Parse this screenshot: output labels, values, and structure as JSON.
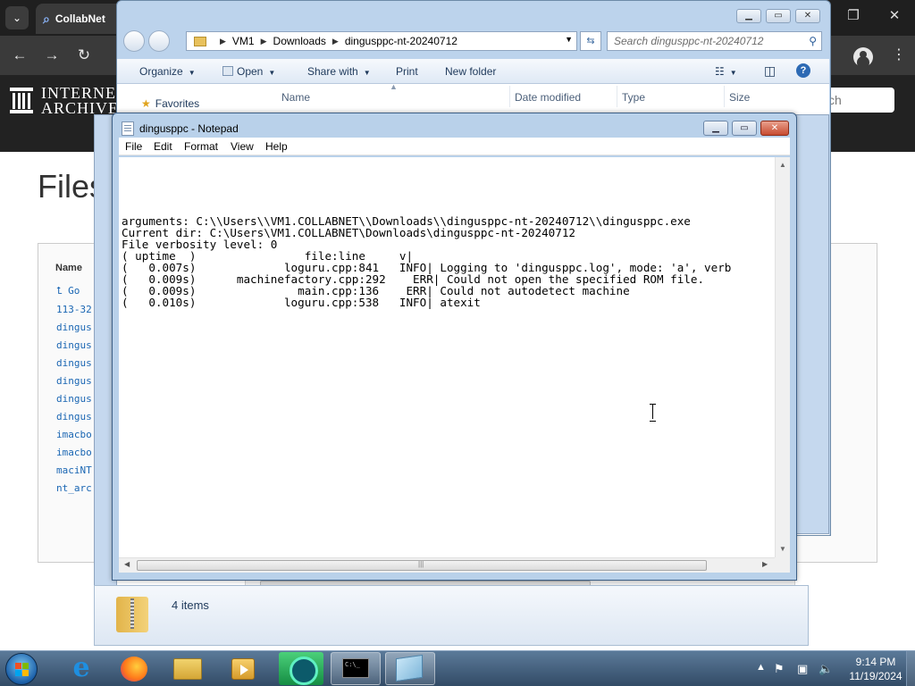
{
  "browser": {
    "tab_title": "CollabNet",
    "ia_logo_text_line1": "INTERNE",
    "ia_logo_text_line2": "ARCHIVE",
    "search_placeholder": "ch",
    "page_title": "Files",
    "files_column_header": "Name",
    "file_links": [
      "Go",
      "113-32",
      "dingus",
      "dingus",
      "dingus",
      "dingus",
      "dingus",
      "dingus",
      "imacbo",
      "imacbo",
      "maciNT",
      "nt_arc"
    ]
  },
  "explorer": {
    "breadcrumb": [
      "VM1",
      "Downloads",
      "dingusppc-nt-20240712"
    ],
    "search_placeholder": "Search dingusppc-nt-20240712",
    "commands": {
      "organize": "Organize",
      "open": "Open",
      "share_with": "Share with",
      "print": "Print",
      "new_folder": "New folder"
    },
    "nav_favorites": "Favorites",
    "columns": {
      "name": "Name",
      "date_modified": "Date modified",
      "type": "Type",
      "size": "Size"
    },
    "details_items": "4 items"
  },
  "notepad": {
    "title": "dingusppc - Notepad",
    "menu": [
      "File",
      "Edit",
      "Format",
      "View",
      "Help"
    ],
    "lines": [
      "arguments: C:\\\\Users\\\\VM1.COLLABNET\\\\Downloads\\\\dingusppc-nt-20240712\\\\dingusppc.exe",
      "Current dir: C:\\Users\\VM1.COLLABNET\\Downloads\\dingusppc-nt-20240712",
      "File verbosity level: 0",
      "( uptime  )                file:line     v|",
      "(   0.007s)             loguru.cpp:841   INFO| Logging to 'dingusppc.log', mode: 'a', verb",
      "(   0.009s)      machinefactory.cpp:292    ERR| Could not open the specified ROM file.",
      "(   0.009s)               main.cpp:136    ERR| Could not autodetect machine",
      "(   0.010s)             loguru.cpp:538   INFO| atexit"
    ]
  },
  "taskbar": {
    "time": "9:14 PM",
    "date": "11/19/2024",
    "cmd_label": "C:\\_"
  },
  "colors": {
    "accent_win7": "#324b66",
    "notepad_close": "#c74b31",
    "link_blue": "#1a66b3"
  }
}
